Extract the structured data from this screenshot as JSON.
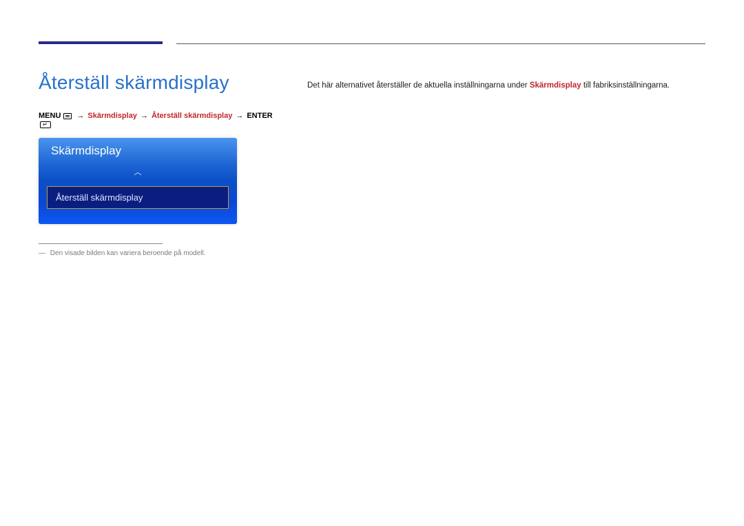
{
  "page": {
    "title": "Återställ skärmdisplay"
  },
  "breadcrumb": {
    "menu": "MENU",
    "arrow": "→",
    "item1": "Skärmdisplay",
    "item2": "Återställ skärmdisplay",
    "enter": "ENTER"
  },
  "osd": {
    "header": "Skärmdisplay",
    "selected": "Återställ skärmdisplay"
  },
  "footnote": {
    "dash": "―",
    "text": "Den visade bilden kan variera beroende på modell."
  },
  "description": {
    "before": "Det här alternativet återställer de aktuella inställningarna under ",
    "highlight": "Skärmdisplay",
    "after": " till fabriksinställningarna."
  }
}
